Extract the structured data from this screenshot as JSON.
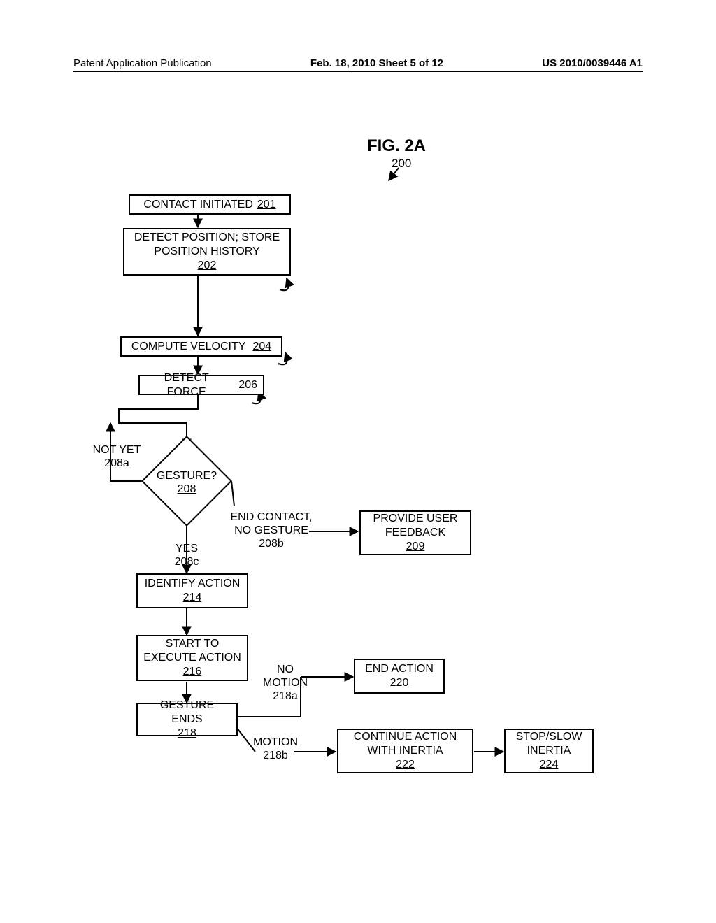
{
  "header": {
    "left": "Patent Application Publication",
    "center": "Feb. 18, 2010  Sheet 5 of 12",
    "right": "US 2010/0039446 A1"
  },
  "figure": {
    "title": "FIG. 2A",
    "ref": "200"
  },
  "boxes": {
    "b201": {
      "text": "CONTACT INITIATED",
      "ref": "201"
    },
    "b202": {
      "text": "DETECT POSITION; STORE POSITION HISTORY",
      "ref": "202"
    },
    "b204": {
      "text": "COMPUTE VELOCITY",
      "ref": "204"
    },
    "b206": {
      "text": "DETECT FORCE",
      "ref": "206"
    },
    "b208": {
      "text": "GESTURE?",
      "ref": "208"
    },
    "b209": {
      "text": "PROVIDE USER FEEDBACK",
      "ref": "209"
    },
    "b214": {
      "text": "IDENTIFY ACTION",
      "ref": "214"
    },
    "b216": {
      "text": "START TO EXECUTE ACTION",
      "ref": "216"
    },
    "b218": {
      "text": "GESTURE ENDS",
      "ref": "218"
    },
    "b220": {
      "text": "END ACTION",
      "ref": "220"
    },
    "b222": {
      "text": "CONTINUE ACTION WITH INERTIA",
      "ref": "222"
    },
    "b224": {
      "text": "STOP/SLOW INERTIA",
      "ref": "224"
    }
  },
  "labels": {
    "l208a_top": "NOT YET",
    "l208a_bot": "208a",
    "l208b_top": "END CONTACT, NO GESTURE",
    "l208b_bot": "208b",
    "l208c_top": "YES",
    "l208c_bot": "208c",
    "l218a_top": "NO MOTION",
    "l218a_bot": "218a",
    "l218b_top": "MOTION",
    "l218b_bot": "218b"
  }
}
